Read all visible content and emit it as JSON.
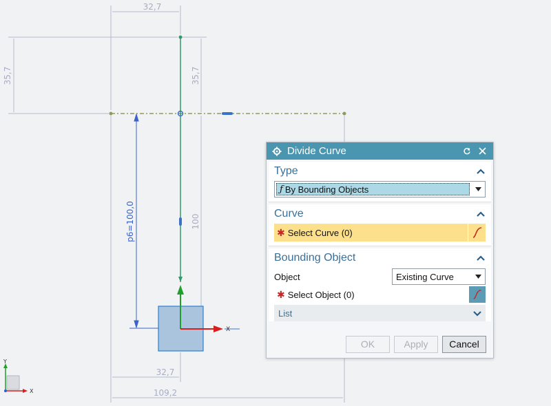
{
  "canvas": {
    "dims": {
      "top_width": "32,7",
      "left_height": "35,7",
      "right_height": "35,7",
      "p6": "p6=100,0",
      "height_100": "100",
      "bottom_width": "32,7",
      "total_width": "109,2"
    },
    "axis_x": "X",
    "triad": {
      "y": "Y",
      "x": "X"
    }
  },
  "dialog": {
    "title": "Divide Curve",
    "type_section": {
      "label": "Type",
      "selected": "By Bounding Objects"
    },
    "curve_section": {
      "label": "Curve",
      "select_label": "Select Curve (0)"
    },
    "bounding_section": {
      "label": "Bounding Object",
      "object_label": "Object",
      "object_value": "Existing Curve",
      "select_label": "Select Object (0)",
      "list_label": "List"
    },
    "buttons": {
      "ok": "OK",
      "apply": "Apply",
      "cancel": "Cancel"
    }
  },
  "colors": {
    "title_bar": "#4a96b0",
    "section_header": "#3a6f97",
    "selection_highlight": "#fde08b",
    "type_highlight": "#add8e6"
  }
}
